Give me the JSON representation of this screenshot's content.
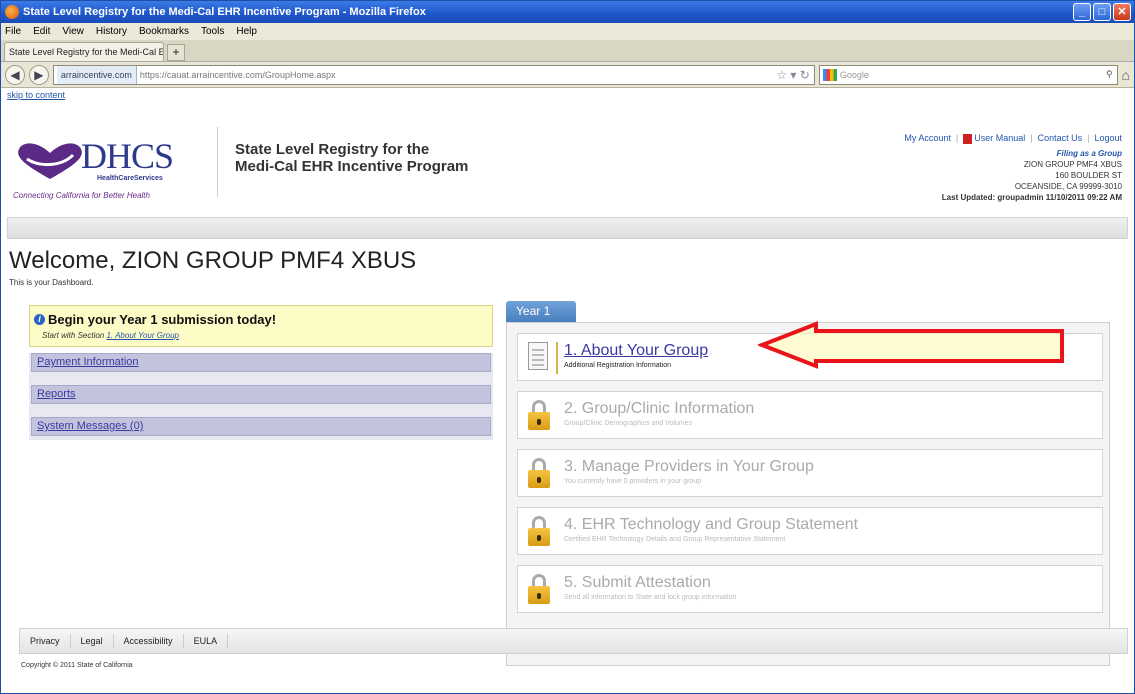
{
  "window": {
    "title": "State Level Registry for the Medi-Cal EHR Incentive Program - Mozilla Firefox"
  },
  "menu": [
    "File",
    "Edit",
    "View",
    "History",
    "Bookmarks",
    "Tools",
    "Help"
  ],
  "browser_tab": {
    "label": "State Level Registry for the Medi-Cal EHR In..."
  },
  "address": {
    "site": "arraincentive.com",
    "url": "https://cauat.arraincentive.com/GroupHome.aspx"
  },
  "search": {
    "placeholder": "Google"
  },
  "skip_link": "skip to content",
  "logo": {
    "text": "DHCS",
    "sub": "HealthCareServices",
    "tagline": "Connecting California for Better Health"
  },
  "app_title": {
    "line1": "State Level Registry for the",
    "line2": "Medi-Cal EHR Incentive Program"
  },
  "top_links": {
    "account": "My Account",
    "manual": "User Manual",
    "contact": "Contact Us",
    "logout": "Logout"
  },
  "account_info": {
    "filing": "Filing as a Group",
    "name": "ZION GROUP PMF4 XBUS",
    "street": "160 BOULDER ST",
    "city": "OCEANSIDE, CA 99999-3010",
    "updated": "Last Updated: groupadmin 11/10/2011 09:22 AM"
  },
  "welcome": {
    "title": "Welcome, ZION GROUP PMF4 XBUS",
    "sub": "This is your Dashboard."
  },
  "begin": {
    "title": "Begin your Year 1 submission today!",
    "prefix": "Start with Section ",
    "link": "1. About Your Group"
  },
  "left_nav": [
    "Payment Information",
    "Reports",
    "System Messages (0)"
  ],
  "year_tab": "Year 1",
  "steps": [
    {
      "title": "1. About Your Group",
      "sub": "Additional Registration Information"
    },
    {
      "title": "2. Group/Clinic Information",
      "sub": "Group/Clinic Demographics and Volumes"
    },
    {
      "title": "3. Manage Providers in Your Group",
      "sub": "You currently have 0 providers in your group"
    },
    {
      "title": "4. EHR Technology and Group Statement",
      "sub": "Certified EHR Technology Details and Group Representative Statement"
    },
    {
      "title": "5. Submit Attestation",
      "sub": "Send all information to State and lock group information"
    }
  ],
  "footer": [
    "Privacy",
    "Legal",
    "Accessibility",
    "EULA"
  ],
  "copyright": "Copyright © 2011 State of California",
  "colors": {
    "title_bar": "#1e55c9",
    "year_tab": "#5a8ecb",
    "begin_box": "#fdfbc6",
    "arrow": "#e8141a",
    "nav_item": "#c3c3dd"
  },
  "icons": {
    "lock": "lock-icon",
    "document": "document-icon",
    "info": "info-icon"
  }
}
